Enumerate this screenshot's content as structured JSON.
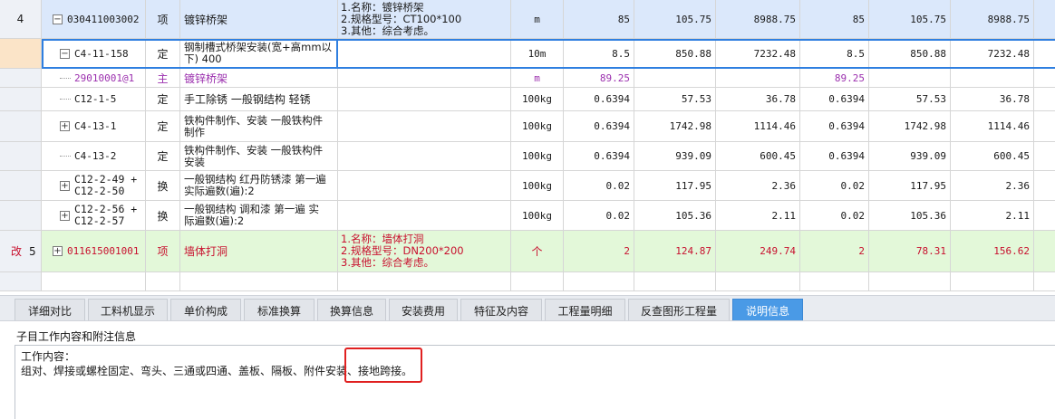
{
  "rows": [
    {
      "rownum": "4",
      "mark": "",
      "toggle": "−",
      "code": "030411003002",
      "type": "项",
      "name": "镀锌桥架",
      "feature": "1.名称：镀锌桥架\n2.规格型号：CT100*100\n3.其他：综合考虑。",
      "unit": "m",
      "qty": "85",
      "price": "105.75",
      "total": "8988.75",
      "qty2": "85",
      "price2": "105.75",
      "total2": "8988.75"
    },
    {
      "toggle": "−",
      "code": "C4-11-158",
      "type": "定",
      "name": "钢制槽式桥架安装(宽+高mm以\n下) 400",
      "feature": "",
      "unit": "10m",
      "qty": "8.5",
      "price": "850.88",
      "total": "7232.48",
      "qty2": "8.5",
      "price2": "850.88",
      "total2": "7232.48"
    },
    {
      "code": "29010001@1",
      "type": "主",
      "name": "镀锌桥架",
      "feature": "",
      "unit": "m",
      "qty": "89.25",
      "price": "",
      "total": "",
      "qty2": "89.25",
      "price2": "",
      "total2": ""
    },
    {
      "code": "C12-1-5",
      "type": "定",
      "name": "手工除锈 一般钢结构 轻锈",
      "feature": "",
      "unit": "100kg",
      "qty": "0.6394",
      "price": "57.53",
      "total": "36.78",
      "qty2": "0.6394",
      "price2": "57.53",
      "total2": "36.78"
    },
    {
      "toggle": "+",
      "code": "C4-13-1",
      "type": "定",
      "name": "铁构件制作、安装 一般铁构件\n制作",
      "feature": "",
      "unit": "100kg",
      "qty": "0.6394",
      "price": "1742.98",
      "total": "1114.46",
      "qty2": "0.6394",
      "price2": "1742.98",
      "total2": "1114.46"
    },
    {
      "code": "C4-13-2",
      "type": "定",
      "name": "铁构件制作、安装 一般铁构件\n安装",
      "feature": "",
      "unit": "100kg",
      "qty": "0.6394",
      "price": "939.09",
      "total": "600.45",
      "qty2": "0.6394",
      "price2": "939.09",
      "total2": "600.45"
    },
    {
      "toggle": "+",
      "code": "C12-2-49 +\nC12-2-50",
      "type": "换",
      "name": "一般钢结构 红丹防锈漆 第一遍\n 实际遍数(遍):2",
      "feature": "",
      "unit": "100kg",
      "qty": "0.02",
      "price": "117.95",
      "total": "2.36",
      "qty2": "0.02",
      "price2": "117.95",
      "total2": "2.36"
    },
    {
      "toggle": "+",
      "code": "C12-2-56 +\nC12-2-57",
      "type": "换",
      "name": "一般钢结构 调和漆 第一遍  实\n际遍数(遍):2",
      "feature": "",
      "unit": "100kg",
      "qty": "0.02",
      "price": "105.36",
      "total": "2.11",
      "qty2": "0.02",
      "price2": "105.36",
      "total2": "2.11"
    },
    {
      "rownum": "5",
      "mark": "改",
      "toggle": "+",
      "code": "011615001001",
      "type": "项",
      "name": "墙体打洞",
      "feature": "1.名称：墙体打洞\n2.规格型号：DN200*200\n3.其他：综合考虑。",
      "unit": "个",
      "qty": "2",
      "price": "124.87",
      "total": "249.74",
      "qty2": "2",
      "price2": "78.31",
      "total2": "156.62"
    }
  ],
  "tabs": [
    "详细对比",
    "工料机显示",
    "单价构成",
    "标准换算",
    "换算信息",
    "安装费用",
    "特征及内容",
    "工程量明细",
    "反查图形工程量",
    "说明信息"
  ],
  "active_tab": "说明信息",
  "panel": {
    "title": "子目工作内容和附注信息",
    "line1": "工作内容：",
    "line2": "组对、焊接或螺栓固定、弯头、三通或四通、盖板、隔板、附件安装、接地跨接。"
  },
  "colors": {
    "selected_border": "#2f7fe0",
    "highlight_box": "#e02020",
    "active_tab": "#4a9ae6"
  }
}
